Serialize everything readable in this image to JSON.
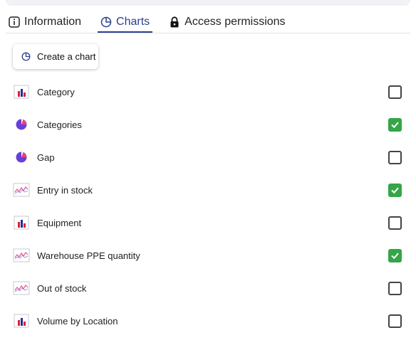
{
  "tabs": {
    "information": "Information",
    "charts": "Charts",
    "access": "Access permissions"
  },
  "create_button": "Create a chart",
  "charts": [
    {
      "label": "Category",
      "icon": "bar-chart-icon",
      "checked": false
    },
    {
      "label": "Categories",
      "icon": "pie-chart-icon",
      "checked": true
    },
    {
      "label": "Gap",
      "icon": "pie-chart-icon",
      "checked": false
    },
    {
      "label": "Entry in stock",
      "icon": "line-chart-icon",
      "checked": true
    },
    {
      "label": "Equipment",
      "icon": "bar-chart-icon",
      "checked": false
    },
    {
      "label": "Warehouse PPE quantity",
      "icon": "line-chart-icon",
      "checked": true
    },
    {
      "label": "Out of stock",
      "icon": "line-chart-icon",
      "checked": false
    },
    {
      "label": "Volume by Location",
      "icon": "bar-chart-icon",
      "checked": false
    }
  ],
  "colors": {
    "accent": "#2c3f8f",
    "checked": "#35a547",
    "bar_red": "#e01e3c",
    "bar_blue": "#1f2f9a",
    "pie_purple": "#6a3fd8",
    "pie_pink": "#e83f86",
    "line_pink": "#d6579b"
  }
}
